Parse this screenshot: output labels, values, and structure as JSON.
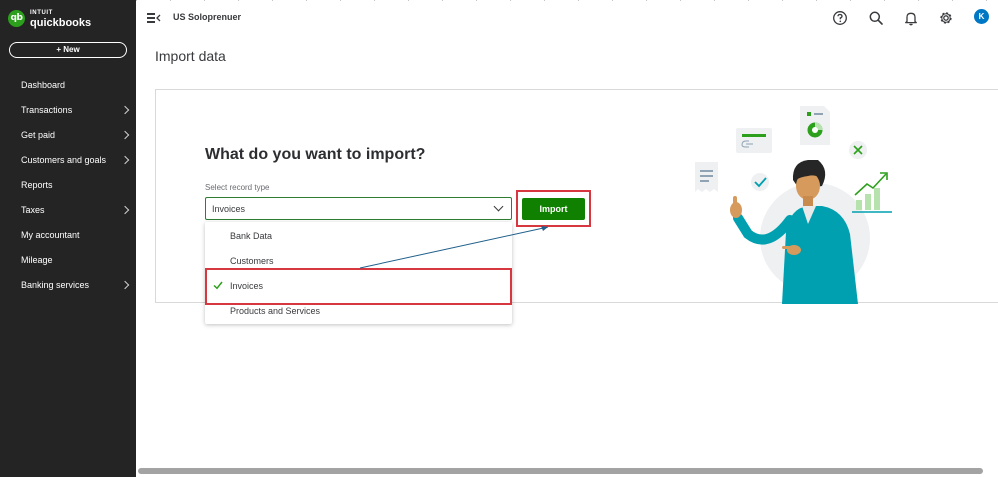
{
  "brand": {
    "mark": "qb",
    "top": "INTUIT",
    "main": "quickbooks"
  },
  "sidebar": {
    "new_label": "+ New",
    "items": [
      {
        "label": "Dashboard",
        "chevron": false
      },
      {
        "label": "Transactions",
        "chevron": true
      },
      {
        "label": "Get paid",
        "chevron": true
      },
      {
        "label": "Customers and goals",
        "chevron": true
      },
      {
        "label": "Reports",
        "chevron": false
      },
      {
        "label": "Taxes",
        "chevron": true
      },
      {
        "label": "My accountant",
        "chevron": false
      },
      {
        "label": "Mileage",
        "chevron": false
      },
      {
        "label": "Banking services",
        "chevron": true
      }
    ]
  },
  "topbar": {
    "company": "US Soloprenuer",
    "icons": [
      "help-icon",
      "search-icon",
      "bell-icon",
      "gear-icon"
    ],
    "avatar_initial": "K"
  },
  "page": {
    "title": "Import data"
  },
  "import": {
    "question": "What do you want to import?",
    "select_label": "Select record type",
    "selected": "Invoices",
    "options": [
      "Bank Data",
      "Customers",
      "Invoices",
      "Products and Services"
    ],
    "button": "Import"
  },
  "colors": {
    "brand_green": "#2ca01c",
    "button_green": "#108000",
    "highlight_red": "#d7373f",
    "sidebar_bg": "#242424",
    "annotation_blue": "#1f5f8b"
  }
}
